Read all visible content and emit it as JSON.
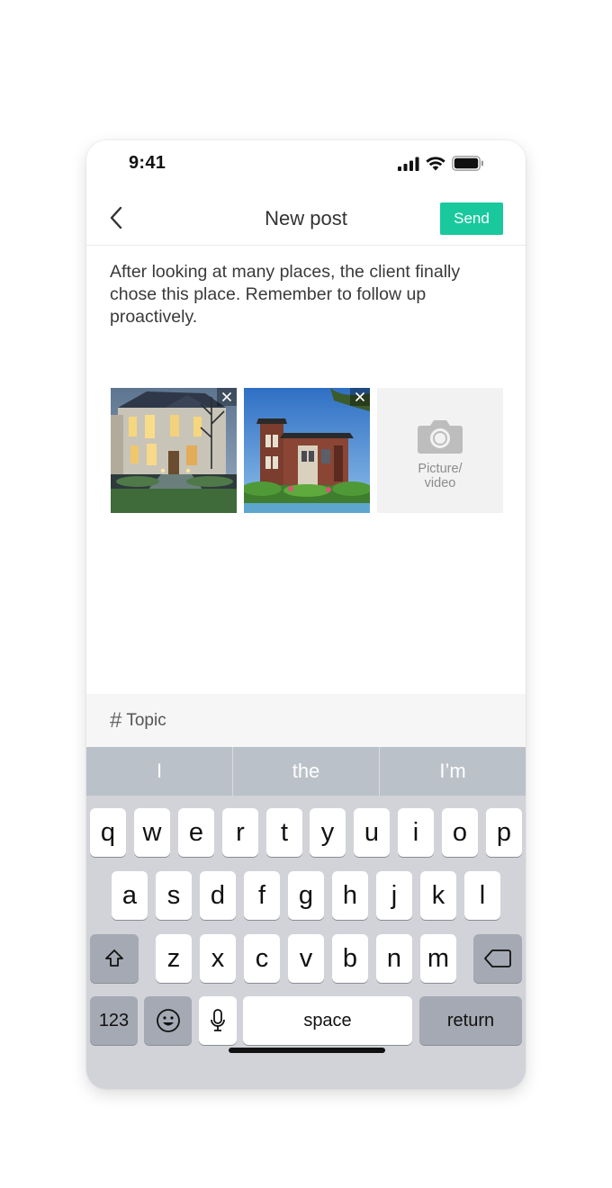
{
  "status_bar": {
    "time": "9:41"
  },
  "nav": {
    "title": "New post",
    "send_label": "Send"
  },
  "post": {
    "body": "After looking at many places, the client finally chose this place. Remember to follow up proactively."
  },
  "media": {
    "items": [
      {
        "subject": "illuminated-mansion-at-dusk"
      },
      {
        "subject": "brick-villa-by-water"
      }
    ],
    "add_label": "Picture/ video"
  },
  "topic": {
    "hash": "#",
    "label": "Topic"
  },
  "keyboard": {
    "suggestions": [
      "I",
      "the",
      "I’m"
    ],
    "row1": [
      "q",
      "w",
      "e",
      "r",
      "t",
      "y",
      "u",
      "i",
      "o",
      "p"
    ],
    "row2": [
      "a",
      "s",
      "d",
      "f",
      "g",
      "h",
      "j",
      "k",
      "l"
    ],
    "row3": [
      "z",
      "x",
      "c",
      "v",
      "b",
      "n",
      "m"
    ],
    "numbers_label": "123",
    "space_label": "space",
    "return_label": "return"
  },
  "colors": {
    "accent": "#19c99d",
    "keyboard_bg": "#d1d3d9",
    "suggestion_bar": "#bbc1c9"
  }
}
